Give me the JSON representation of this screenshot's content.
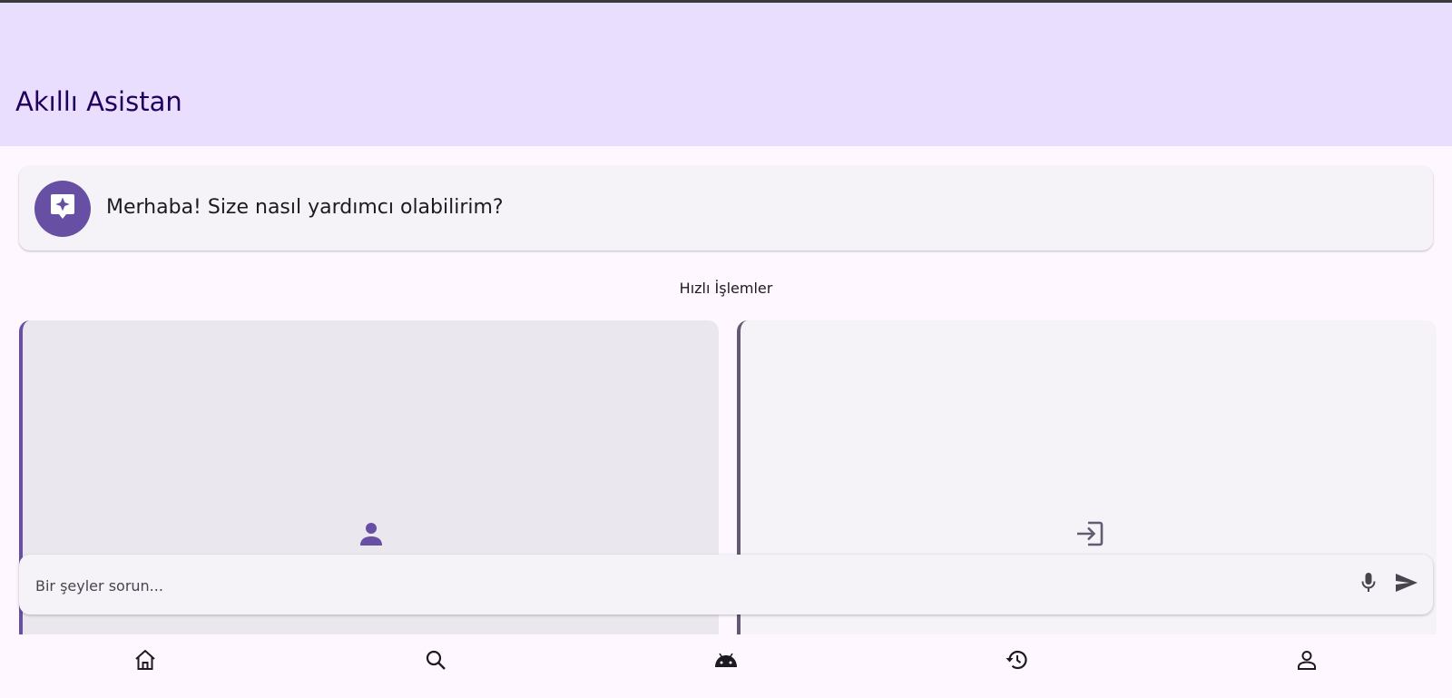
{
  "app_bar": {
    "title": "Akıllı Asistan"
  },
  "greeting": {
    "icon": "assistant-sparkle-icon",
    "text": "Merhaba! Size nasıl yardımcı olabilirim?"
  },
  "quick_actions": {
    "title": "Hızlı İşlemler",
    "cards": [
      {
        "icon": "person-icon",
        "accent": "#6750a4"
      },
      {
        "icon": "login-icon",
        "accent": "#625b71"
      }
    ]
  },
  "input": {
    "placeholder": "Bir şeyler sorun...",
    "mic_icon": "mic-icon",
    "send_icon": "send-icon"
  },
  "bottom_nav": {
    "items": [
      {
        "icon": "home-icon"
      },
      {
        "icon": "search-icon"
      },
      {
        "icon": "android-icon"
      },
      {
        "icon": "history-icon"
      },
      {
        "icon": "profile-icon"
      }
    ]
  },
  "colors": {
    "primary": "#6750a4",
    "app_bar_bg": "#eadeff",
    "background": "#fef7ff",
    "surface": "#f5f2f8"
  }
}
